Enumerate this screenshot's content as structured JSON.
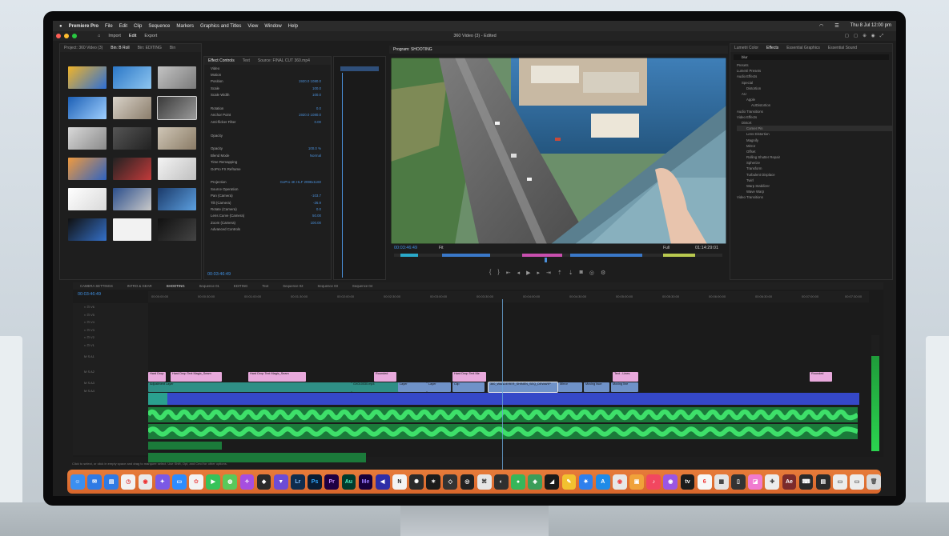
{
  "menubar": {
    "app": "Premiere Pro",
    "items": [
      "File",
      "Edit",
      "Clip",
      "Sequence",
      "Markers",
      "Graphics and Titles",
      "View",
      "Window",
      "Help"
    ],
    "clock": "Thu 8 Jul  12:00 pm"
  },
  "app_header": {
    "nav": [
      "Import",
      "Edit",
      "Export"
    ],
    "title": "360 Video (3) - Edited"
  },
  "project_panel": {
    "tabs": [
      "Project: 360 Video (3)",
      "Bin: B Roll",
      "Bin: EDITING",
      "Bin"
    ]
  },
  "effect_controls": {
    "tabs": [
      "Effect Controls",
      "Text",
      "Source: FINAL CUT 360.mp4"
    ],
    "rows": [
      {
        "label": "Video",
        "value": ""
      },
      {
        "label": "Motion",
        "value": ""
      },
      {
        "label": "Position",
        "value": "1920.0  1080.0"
      },
      {
        "label": "Scale",
        "value": "100.0"
      },
      {
        "label": "Scale Width",
        "value": "100.0"
      },
      {
        "label": "",
        "value": ""
      },
      {
        "label": "Rotation",
        "value": "0.0"
      },
      {
        "label": "Anchor Point",
        "value": "1920.0  1080.0"
      },
      {
        "label": "Anti-flicker Filter",
        "value": "0.00"
      },
      {
        "label": "",
        "value": ""
      },
      {
        "label": "Opacity",
        "value": ""
      },
      {
        "label": "",
        "value": ""
      },
      {
        "label": "Opacity",
        "value": "100.0 %"
      },
      {
        "label": "Blend Mode",
        "value": "Normal"
      },
      {
        "label": "Time Remapping",
        "value": ""
      },
      {
        "label": "GoPro FX Reframe",
        "value": ""
      },
      {
        "label": "",
        "value": ""
      },
      {
        "label": "Projection",
        "value": "GoPro 4K HLF 2998x1160"
      },
      {
        "label": "Source Operation",
        "value": ""
      },
      {
        "label": "Pan (Camera)",
        "value": "-103.7"
      },
      {
        "label": "Tilt (Camera)",
        "value": "-26.9"
      },
      {
        "label": "Rotate (Camera)",
        "value": "0.0"
      },
      {
        "label": "Lens Curve (Camera)",
        "value": "50.00"
      },
      {
        "label": "Zoom (Camera)",
        "value": "100.00"
      },
      {
        "label": "Advanced Controls",
        "value": ""
      }
    ],
    "timecode": "00:03:46:49"
  },
  "program_monitor": {
    "tab": "Program: SHOOTING",
    "timecode_left": "00:03:46:49",
    "timecode_right": "01:14:29:01",
    "fit": "Fit",
    "quality": "Full"
  },
  "effects_panel": {
    "tabs": [
      "Lumetri Color",
      "Effects",
      "Essential Graphics",
      "Essential Sound"
    ],
    "search": "blur",
    "tree": [
      "Presets",
      "Lumetri Presets",
      "Audio Effects",
      "Special",
      "Distortion",
      "AU",
      "Apple",
      "AUDistortion",
      "Audio Transitions",
      "Video Effects",
      "Distort",
      "Corner Pin",
      "Lens Distortion",
      "Magnify",
      "Mirror",
      "Offset",
      "Rolling Shutter Repair",
      "Spherize",
      "Transform",
      "Turbulent Displace",
      "Twirl",
      "Warp Stabilizer",
      "Wave Warp",
      "Video Transitions"
    ]
  },
  "timeline": {
    "tabs": [
      "CAMERA SETTINGS",
      "INTRO & GEAR",
      "SHOOTING",
      "Sequence 01",
      "EDITING",
      "Text",
      "Sequence 02",
      "Sequence 03",
      "Sequence 04"
    ],
    "timecode": "00:03:46:49",
    "ruler": [
      "00:00:00:00",
      "00:00:30:00",
      "00:01:00:00",
      "00:01:30:00",
      "00:02:00:00",
      "00:02:30:00",
      "00:03:00:00",
      "00:03:30:00",
      "00:04:00:00",
      "00:04:30:00",
      "00:05:00:00",
      "00:05:30:00",
      "00:06:00:00",
      "00:06:30:00",
      "00:07:00:00",
      "00:07:30:00"
    ],
    "graphics_clips": [
      "Hard Drop",
      "Hard Drop Text Magic_Seam",
      "Hard Drop Text Magic_Seam",
      "Rounded",
      "Hard Drop Text Me",
      "Text - Lines",
      "Rounded"
    ],
    "video_clips": [
      "Adjustment Layer",
      "GX010030.mp4",
      "Layer",
      "Layer",
      "Clip",
      "360_WANDERER_SHINEN_SEQ_DEWARP",
      "Mirror",
      "Moving face",
      "Moving line"
    ]
  },
  "status_bar": "Click to select, or click in empty space and drag to marquee select. Use Shift, Opt, and Cmd for other options.",
  "dock": {
    "apps": [
      "Finder",
      "Mail",
      "Messages",
      "Safari",
      "Chrome",
      "Facetime",
      "Zoom",
      "Photos",
      "Notes",
      "Reminders",
      "Calendar",
      "Slack",
      "Spotify",
      "Lightroom",
      "Photoshop",
      "Premiere",
      "Audition",
      "Media Encoder",
      "Brave",
      "Notion",
      "DaVinci",
      "Final Cut",
      "Motion",
      "Compressor",
      "Logic",
      "Preview",
      "Music",
      "Podcasts",
      "TV",
      "App Store",
      "System Preferences",
      "Calculator",
      "Trash"
    ]
  }
}
